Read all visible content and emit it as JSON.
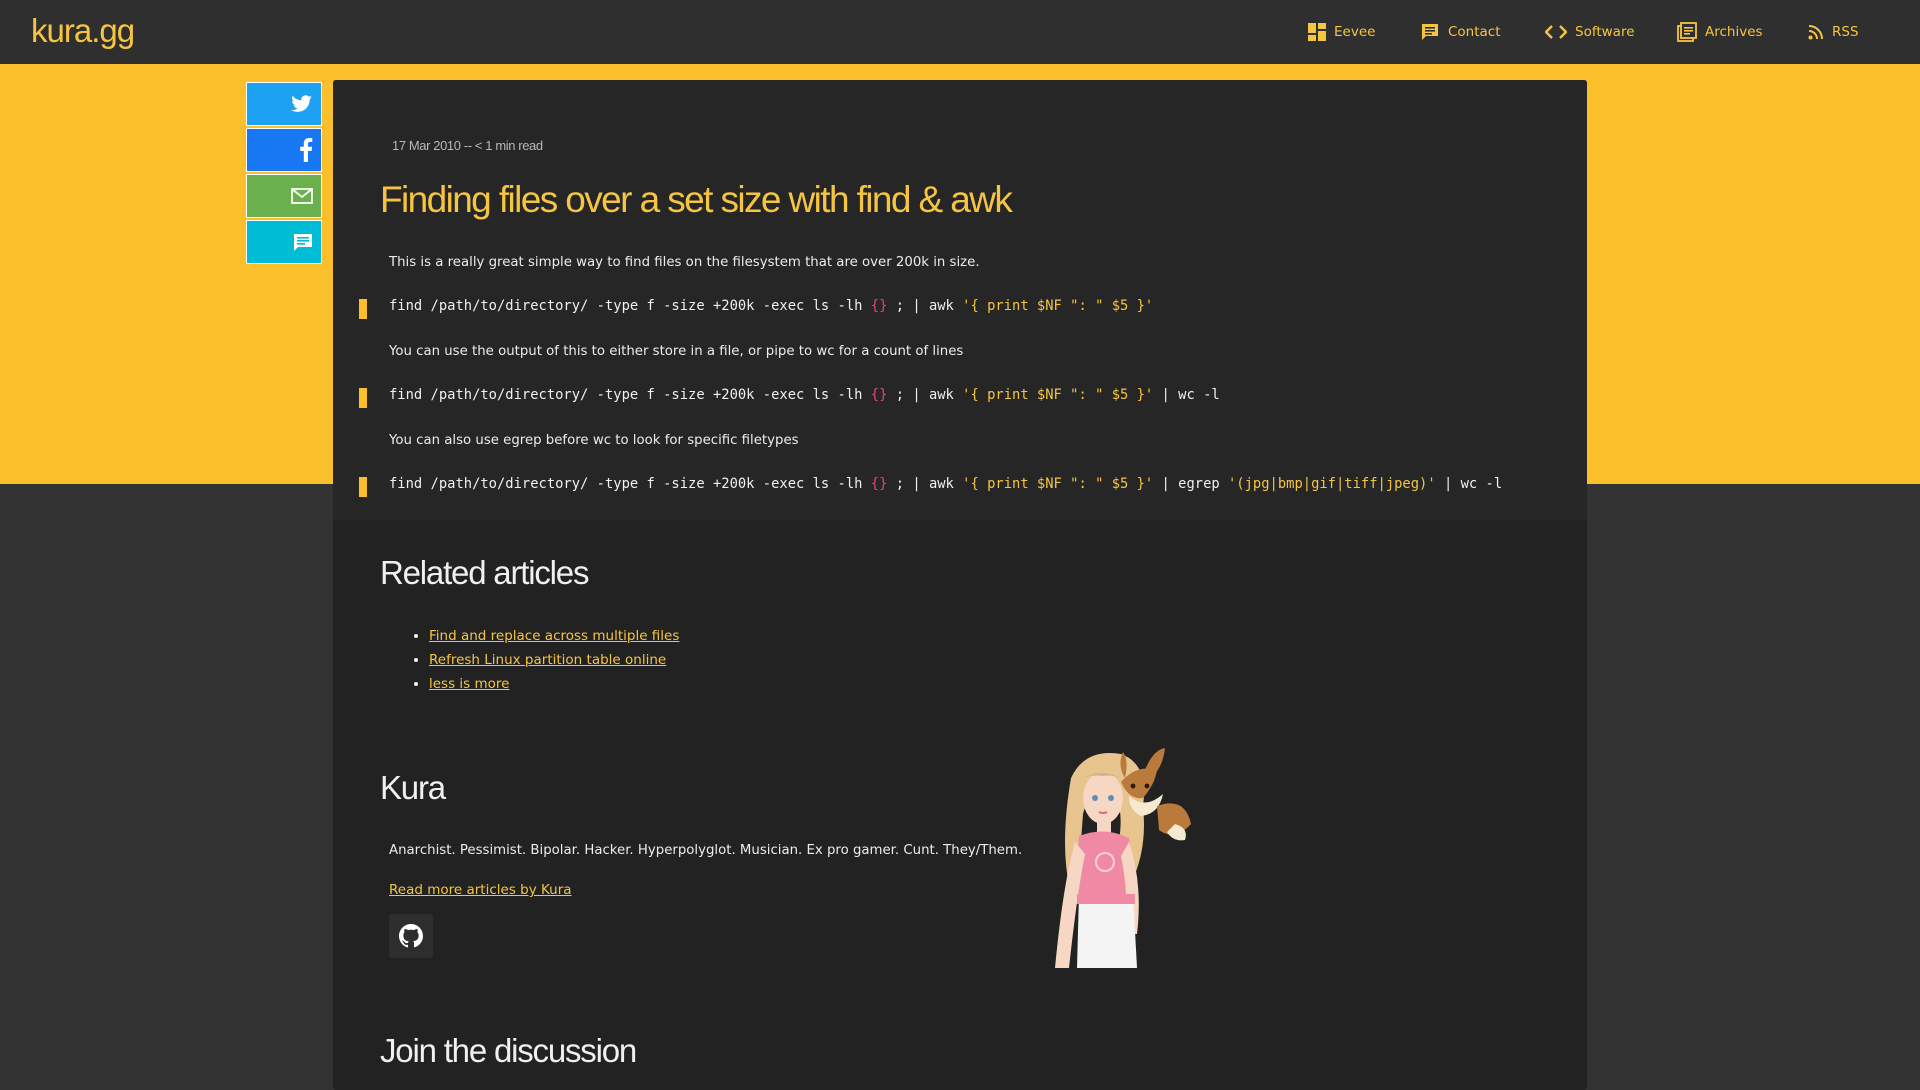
{
  "site": {
    "logo": "kura.gg"
  },
  "nav": [
    {
      "label": "Eevee",
      "icon": "dashboard-icon"
    },
    {
      "label": "Contact",
      "icon": "chat-icon"
    },
    {
      "label": "Software",
      "icon": "code-icon"
    },
    {
      "label": "Archives",
      "icon": "book-icon"
    },
    {
      "label": "RSS",
      "icon": "rss-icon"
    }
  ],
  "share": [
    {
      "network": "twitter",
      "icon": "twitter-icon",
      "color": "#1da1f2"
    },
    {
      "network": "facebook",
      "icon": "facebook-icon",
      "color": "#1877f2"
    },
    {
      "network": "email",
      "icon": "mail-icon",
      "color": "#6ab04c"
    },
    {
      "network": "comments",
      "icon": "comment-icon",
      "color": "#00bcd4"
    }
  ],
  "article": {
    "meta": "17 Mar 2010 -- < 1 min read",
    "title": "Finding files over a set size with find & awk",
    "p1": "This is a really great simple way to find files on the filesystem that are over 200k in size.",
    "code1": {
      "cmd": "find /path/to/directory/ -type f -size +200k -exec ls -lh ",
      "braces": "{}",
      "mid": " ; | awk ",
      "str": "'{ print $NF \": \" $5 }'"
    },
    "p2": "You can use the output of this to either store in a file, or pipe to wc for a count of lines",
    "code2": {
      "cmd": "find /path/to/directory/ -type f -size +200k -exec ls -lh ",
      "braces": "{}",
      "mid": " ; | awk ",
      "str": "'{ print $NF \": \" $5 }'",
      "tail": " | wc -l"
    },
    "p3": "You can also use egrep before wc to look for specific filetypes",
    "code3": {
      "cmd": "find /path/to/directory/ -type f -size +200k -exec ls -lh ",
      "braces": "{}",
      "mid": " ; | awk ",
      "str": "'{ print $NF \": \" $5 }'",
      "pipe": " | egrep ",
      "str2": "'(jpg|bmp|gif|tiff|jpeg)'",
      "tail": " | wc -l"
    }
  },
  "related": {
    "heading": "Related articles",
    "items": [
      "Find and replace across multiple files",
      "Refresh Linux partition table online",
      "less is more"
    ]
  },
  "author": {
    "name": "Kura",
    "bio": "Anarchist. Pessimist. Bipolar. Hacker. Hyperpolyglot. Musician. Ex pro gamer. Cunt. They/Them.",
    "more_link": "Read more articles by Kura",
    "social_icon": "github-icon"
  },
  "discussion": {
    "heading": "Join the discussion"
  }
}
